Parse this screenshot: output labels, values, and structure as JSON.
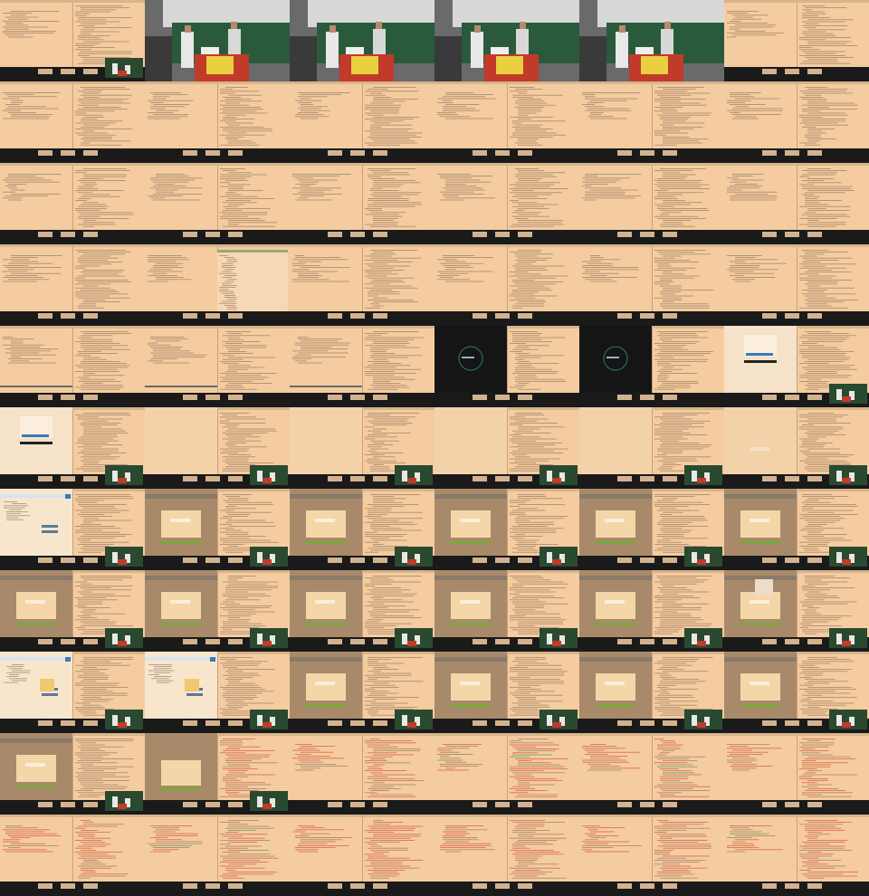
{
  "sheet": {
    "columns": 6,
    "rows": 11,
    "frames": [
      "ide-cam",
      "stage-wide",
      "stage-wide",
      "stage-gesture",
      "stage-gesture",
      "ide",
      "ide",
      "ide",
      "ide",
      "ide",
      "ide",
      "ide",
      "ide",
      "ide",
      "ide",
      "ide",
      "ide",
      "ide",
      "ide",
      "ide-list",
      "ide",
      "ide",
      "ide",
      "ide",
      "ide-term",
      "ide-term",
      "ide-term",
      "dark-loader",
      "dark-loader",
      "login-cam",
      "login-cam",
      "blank-cam",
      "blank-cam",
      "blank-cam",
      "blank-cam",
      "blank-dialog-cam",
      "webapp-cam",
      "modal-cam",
      "modal-cam",
      "modal-cam",
      "modal-cam",
      "modal-cam",
      "modal-cam",
      "modal-cam",
      "modal-cam",
      "modal-cam",
      "modal-cam",
      "modal-popup-cam",
      "webapp-yellow-cam",
      "webapp-yellow-cam",
      "modal-cam",
      "modal-cam",
      "modal-cam",
      "modal-cam",
      "modal-cam",
      "errors-cam",
      "errors",
      "errors",
      "errors",
      "errors",
      "errors",
      "errors",
      "errors",
      "errors",
      "errors",
      "errors"
    ]
  },
  "colors": {
    "editor_bg": "#f4cca0",
    "editor_bg_light": "#f7d8b4",
    "code_line": "#8a6a52",
    "code_red": "#d03a2a",
    "code_green": "#3a8a3a",
    "taskbar": "#1a1a1a",
    "stand": "#e8c49c",
    "dark_screen": "#151515",
    "dim_overlay": "#a88a6a",
    "modal_bg": "#f4d6a8",
    "accent_green": "#7aa83a",
    "accent_blue": "#3a7ab8",
    "stage_wall": "#2a5a3c",
    "stage_desk": "#c23a2a",
    "stage_sign": "#e8d040"
  }
}
